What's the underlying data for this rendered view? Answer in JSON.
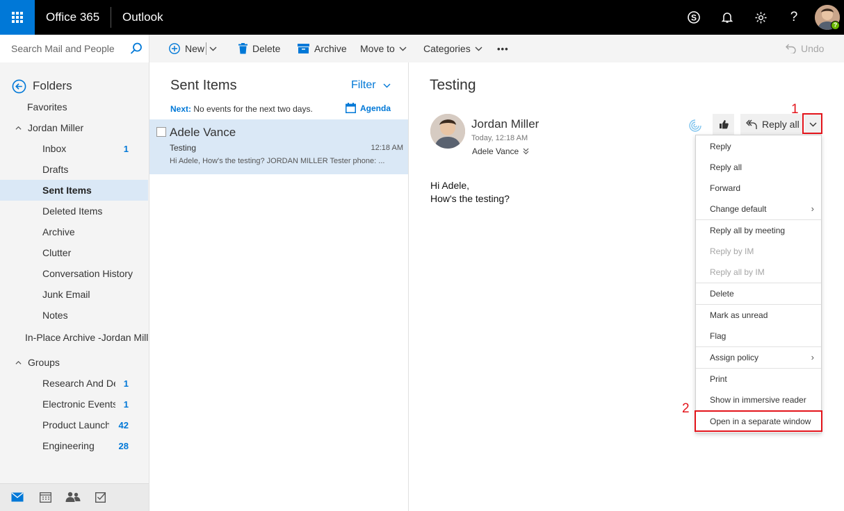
{
  "topbar": {
    "suite_name": "Office 365",
    "app_name": "Outlook"
  },
  "search": {
    "placeholder": "Search Mail and People"
  },
  "toolbar": {
    "new_label": "New",
    "delete_label": "Delete",
    "archive_label": "Archive",
    "move_to_label": "Move to",
    "categories_label": "Categories",
    "more_label": "•••",
    "undo_label": "Undo"
  },
  "folders": {
    "header": "Folders",
    "favorites": "Favorites",
    "account": "Jordan Miller",
    "items": [
      {
        "label": "Inbox",
        "count": "1"
      },
      {
        "label": "Drafts",
        "count": ""
      },
      {
        "label": "Sent Items",
        "count": ""
      },
      {
        "label": "Deleted Items",
        "count": ""
      },
      {
        "label": "Archive",
        "count": ""
      },
      {
        "label": "Clutter",
        "count": ""
      },
      {
        "label": "Conversation History",
        "count": ""
      },
      {
        "label": "Junk Email",
        "count": ""
      },
      {
        "label": "Notes",
        "count": ""
      }
    ],
    "archive_mailbox": "In-Place Archive -Jordan Mille",
    "groups_header": "Groups",
    "groups": [
      {
        "label": "Research And De",
        "count": "1"
      },
      {
        "label": "Electronic Events",
        "count": "1"
      },
      {
        "label": "Product Launch E",
        "count": "42"
      },
      {
        "label": "Engineering",
        "count": "28"
      }
    ]
  },
  "list": {
    "title": "Sent Items",
    "filter_label": "Filter",
    "next_label": "Next:",
    "next_text": "No events for the next two days.",
    "agenda_label": "Agenda",
    "messages": [
      {
        "recipient": "Adele Vance",
        "subject": "Testing",
        "time": "12:18 AM",
        "preview": "Hi Adele,  How's the testing?  JORDAN MILLER Tester phone: ..."
      }
    ]
  },
  "reading": {
    "subject": "Testing",
    "sender": "Jordan Miller",
    "datetime": "Today, 12:18 AM",
    "to": "Adele Vance",
    "reply_all_label": "Reply all",
    "body_lines": [
      "Hi Adele,",
      "How's the testing?"
    ]
  },
  "reply_menu": {
    "items": [
      {
        "label": "Reply",
        "disabled": false,
        "submenu": false
      },
      {
        "label": "Reply all",
        "disabled": false,
        "submenu": false
      },
      {
        "label": "Forward",
        "disabled": false,
        "submenu": false
      },
      {
        "label": "Change default",
        "disabled": false,
        "submenu": true
      },
      {
        "label": "Reply all by meeting",
        "disabled": false,
        "submenu": false
      },
      {
        "label": "Reply by IM",
        "disabled": true,
        "submenu": false
      },
      {
        "label": "Reply all by IM",
        "disabled": true,
        "submenu": false
      },
      {
        "label": "Delete",
        "disabled": false,
        "submenu": false
      },
      {
        "label": "Mark as unread",
        "disabled": false,
        "submenu": false
      },
      {
        "label": "Flag",
        "disabled": false,
        "submenu": false
      },
      {
        "label": "Assign policy",
        "disabled": false,
        "submenu": true
      },
      {
        "label": "Print",
        "disabled": false,
        "submenu": false
      },
      {
        "label": "Show in immersive reader",
        "disabled": false,
        "submenu": false
      },
      {
        "label": "Open in a separate window",
        "disabled": false,
        "submenu": false
      }
    ]
  },
  "annotations": {
    "step1": "1",
    "step2": "2",
    "highlight_color": "#e3141b"
  },
  "colors": {
    "accent": "#0078d7",
    "selection": "#dae8f6",
    "topbar": "#000000"
  },
  "icons": [
    "app-launcher-icon",
    "skype-icon",
    "bell-icon",
    "gear-icon",
    "help-icon",
    "search-icon",
    "plus-circle-icon",
    "trash-icon",
    "archive-icon",
    "undo-icon",
    "back-arrow-icon",
    "calendar-icon",
    "like-icon",
    "reply-all-icon",
    "chevron-down-icon",
    "mail-icon",
    "people-icon",
    "tasks-icon"
  ]
}
